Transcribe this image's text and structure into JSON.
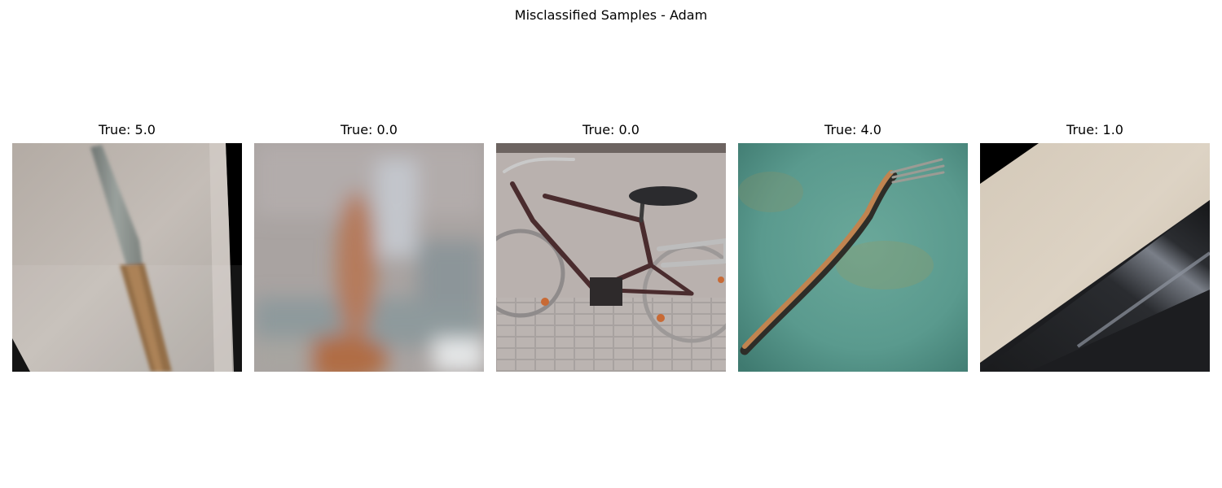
{
  "figure": {
    "title": "Misclassified Samples - Adam"
  },
  "samples": [
    {
      "label": "True: 5.0",
      "subject": "knife"
    },
    {
      "label": "True: 0.0",
      "subject": "blurred object"
    },
    {
      "label": "True: 0.0",
      "subject": "bicycle"
    },
    {
      "label": "True: 4.0",
      "subject": "fork"
    },
    {
      "label": "True: 1.0",
      "subject": "dark cylinder"
    }
  ]
}
